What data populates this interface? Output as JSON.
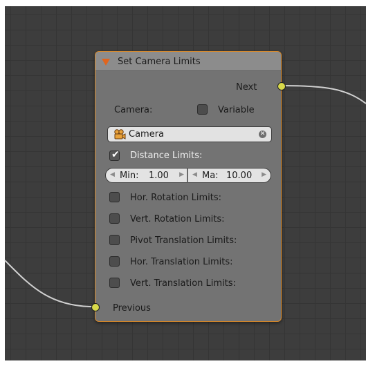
{
  "node": {
    "title": "Set Camera Limits",
    "next_label": "Next",
    "previous_label": "Previous",
    "camera_label": "Camera:",
    "variable_label": "Variable",
    "camera_value": "Camera",
    "distance_label": "Distance Limits:",
    "min_label": "Min:",
    "min_value": "1.00",
    "max_label": "Ma:",
    "max_value": "10.00",
    "options": [
      {
        "label": "Hor. Rotation Limits:",
        "checked": false
      },
      {
        "label": "Vert. Rotation Limits:",
        "checked": false
      },
      {
        "label": "Pivot Translation Limits:",
        "checked": false
      },
      {
        "label": "Hor. Translation Limits:",
        "checked": false
      },
      {
        "label": "Vert. Translation Limits:",
        "checked": false
      }
    ],
    "variable_checked": false,
    "distance_checked": true
  },
  "icons": {
    "collapse": "triangle-down-icon",
    "camera": "camera-icon",
    "clear": "clear-icon",
    "check": "check-icon"
  },
  "colors": {
    "node_border": "#d98a2b",
    "socket": "#d8d94a",
    "collapse_arrow": "#e0651e",
    "canvas": "#3d3d3d"
  }
}
